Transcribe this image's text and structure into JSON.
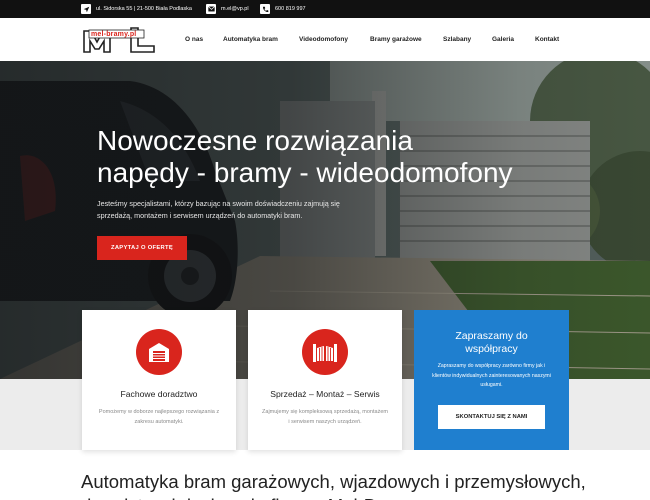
{
  "topbar": {
    "address": "ul. Sidorska 55 | 21-500 Biała Podlaska",
    "email": "m.el@vp.pl",
    "phone": "600 819 997"
  },
  "logo": {
    "text": "mel-bramy.pl",
    "mark": "M&L"
  },
  "nav": {
    "items": [
      "O nas",
      "Automatyka bram",
      "Videodomofony",
      "Bramy garażowe",
      "Szlabany",
      "Galeria",
      "Kontakt"
    ]
  },
  "hero": {
    "title_line1": "Nowoczesne rozwiązania",
    "title_line2": "napędy - bramy - wideodomofony",
    "description": "Jesteśmy specjalistami, którzy bazując na swoim doświadczeniu zajmują się sprzedażą, montażem i serwisem urządzeń do automatyki bram.",
    "button": "ZAPYTAJ O OFERTĘ"
  },
  "cards": [
    {
      "title": "Fachowe doradztwo",
      "text": "Pomożemy w doborze najlepszego rozwiązania z zakresu automatyki.",
      "icon": "garage-door-icon"
    },
    {
      "title": "Sprzedaż – Montaż – Serwis",
      "text": "Zajmujemy się kompleksową sprzedażą, montażem i serwisem naszych urządzeń.",
      "icon": "gate-icon"
    }
  ],
  "cooperation": {
    "title_line1": "Zapraszamy do",
    "title_line2": "współpracy",
    "text": "Zapraszamy do współpracy zarówno firmy jak i klientów indywidualnych zainteresowanych naszymi usługami.",
    "button": "SKONTAKTUJ SIĘ Z NAMI"
  },
  "bottom": {
    "heading": "Automatyka bram garażowych, wjazdowych i przemysłowych, doradztwo i doskonała firma - Mel-Bramy"
  },
  "colors": {
    "accent_red": "#d9251d",
    "accent_blue": "#1f7fcf",
    "topbar": "#111111"
  }
}
